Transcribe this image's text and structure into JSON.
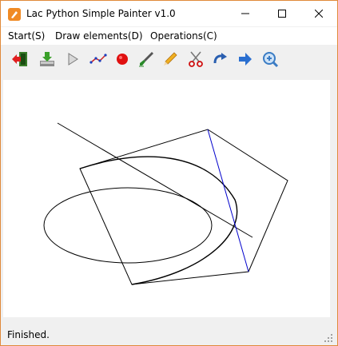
{
  "window": {
    "title": "Lac Python Simple Painter v1.0"
  },
  "menu": {
    "items": [
      "Start(S)",
      "Draw elements(D)",
      "Operations(C)"
    ]
  },
  "toolbar": {
    "tools": [
      "exit-icon",
      "save-icon",
      "play-icon",
      "polyline-icon",
      "record-dot-icon",
      "brush-icon",
      "pencil-icon",
      "scissors-icon",
      "redo-arrow-icon",
      "forward-arrow-icon",
      "zoom-in-icon"
    ]
  },
  "canvas": {
    "background": "#ffffff"
  },
  "status": {
    "text": "Finished."
  },
  "colors": {
    "window_border": "#e08a3a",
    "app_icon": "#f08a24",
    "chrome_bg": "#f0f0f0",
    "blue_line": "#0000cc"
  }
}
